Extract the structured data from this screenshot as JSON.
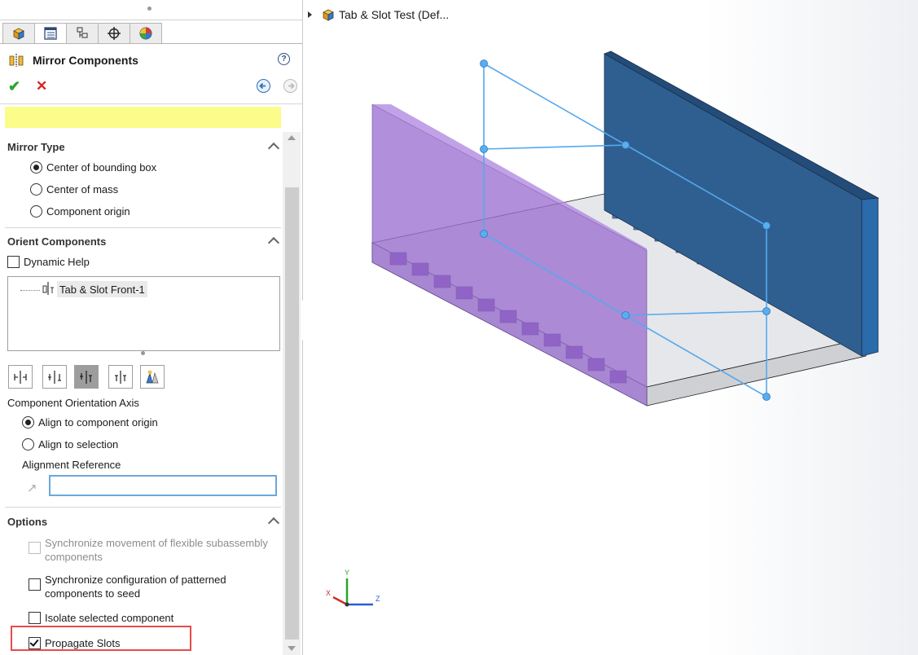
{
  "panel": {
    "title": "Mirror Components",
    "tabs": [
      "feature-manager",
      "property-manager",
      "configuration-manager",
      "dimxpert-manager",
      "display-manager"
    ],
    "mirror_type": {
      "heading": "Mirror Type",
      "options": [
        "Center of bounding box",
        "Center of mass",
        "Component origin"
      ],
      "selected": "Center of bounding box"
    },
    "orient": {
      "heading": "Orient Components",
      "dynamic_help": "Dynamic Help",
      "list_item": "Tab & Slot Front-1",
      "axis_label": "Component Orientation Axis",
      "axis_options": [
        "Align to component origin",
        "Align to selection"
      ],
      "axis_selected": "Align to component origin",
      "alignment_ref_label": "Alignment Reference",
      "alignment_ref_value": ""
    },
    "options": {
      "heading": "Options",
      "sync_flex_line1": "Synchronize movement of flexible subassembly",
      "sync_flex_line2": "components",
      "sync_config_line1": "Synchronize configuration of patterned",
      "sync_config_line2": "components to seed",
      "isolate": "Isolate selected component",
      "propagate": "Propagate Slots",
      "propagate_checked": true
    }
  },
  "viewport": {
    "tree_title": "Tab & Slot Test  (Def...",
    "axes": {
      "x": "X",
      "y": "Y",
      "z": "Z"
    }
  },
  "colors": {
    "message_bar": "#fcfc8a",
    "purple_part": "#9b6fcf",
    "blue_part": "#2f5f91",
    "mirror_plane": "#55a9ee",
    "highlight": "#e64b4b"
  }
}
